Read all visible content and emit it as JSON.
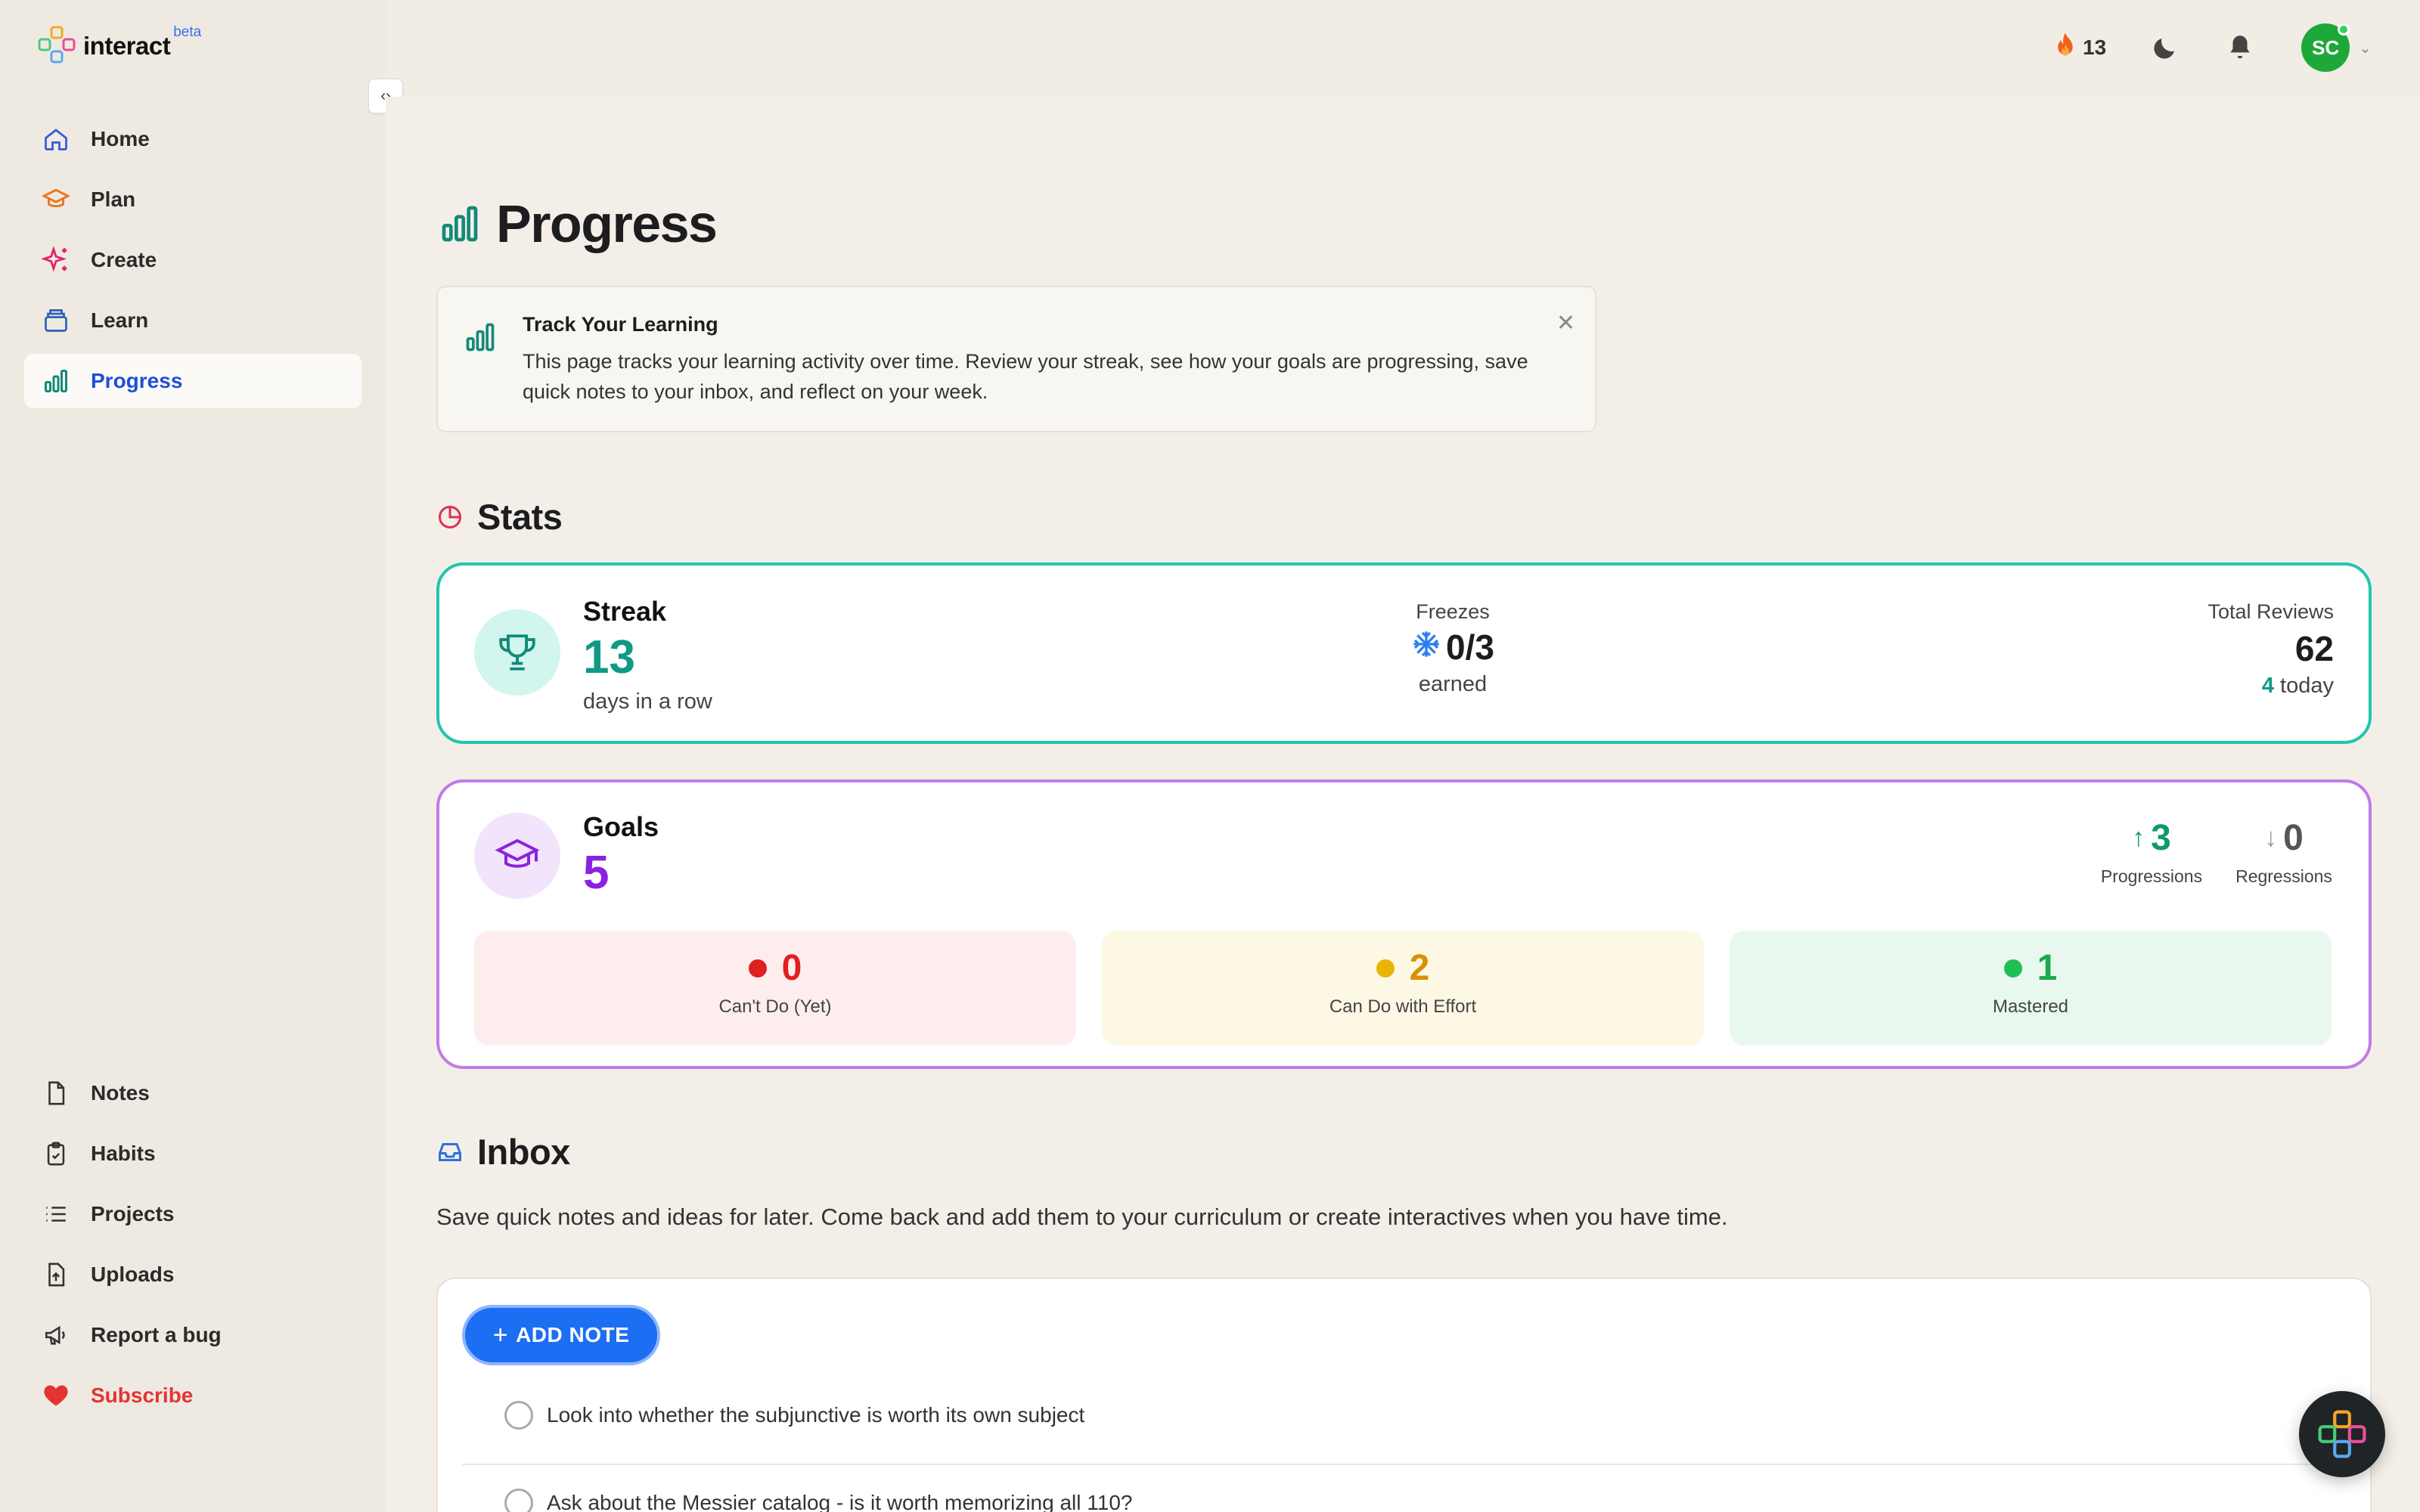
{
  "app": {
    "brand": "interact",
    "beta": "beta"
  },
  "sidebar": {
    "top_items": [
      {
        "label": "Home",
        "icon": "home-icon"
      },
      {
        "label": "Plan",
        "icon": "graduation-cap-icon"
      },
      {
        "label": "Create",
        "icon": "sparkles-icon"
      },
      {
        "label": "Learn",
        "icon": "layers-icon"
      },
      {
        "label": "Progress",
        "icon": "bar-chart-icon",
        "active": true
      }
    ],
    "bottom_items": [
      {
        "label": "Notes",
        "icon": "file-icon"
      },
      {
        "label": "Habits",
        "icon": "clipboard-check-icon"
      },
      {
        "label": "Projects",
        "icon": "list-icon"
      },
      {
        "label": "Uploads",
        "icon": "upload-file-icon"
      },
      {
        "label": "Report a bug",
        "icon": "megaphone-icon"
      },
      {
        "label": "Subscribe",
        "icon": "heart-icon"
      }
    ]
  },
  "topbar": {
    "streak_count": "13",
    "avatar_initials": "SC"
  },
  "page": {
    "title": "Progress"
  },
  "info": {
    "title": "Track Your Learning",
    "text": "This page tracks your learning activity over time. Review your streak, see how your goals are progressing, save quick notes to your inbox, and reflect on your week."
  },
  "stats": {
    "heading": "Stats",
    "streak": {
      "label": "Streak",
      "value": "13",
      "sub": "days in a row"
    },
    "freezes": {
      "label": "Freezes",
      "value": "0/3",
      "sub": "earned"
    },
    "reviews": {
      "label": "Total Reviews",
      "value": "62",
      "today_count": "4",
      "today_label": "today"
    }
  },
  "goals": {
    "label": "Goals",
    "value": "5",
    "progressions": {
      "value": "3",
      "label": "Progressions"
    },
    "regressions": {
      "value": "0",
      "label": "Regressions"
    },
    "tiles": [
      {
        "value": "0",
        "label": "Can't Do (Yet)"
      },
      {
        "value": "2",
        "label": "Can Do with Effort"
      },
      {
        "value": "1",
        "label": "Mastered"
      }
    ]
  },
  "inbox": {
    "heading": "Inbox",
    "description": "Save quick notes and ideas for later. Come back and add them to your curriculum or create interactives when you have time.",
    "add_button": "ADD NOTE",
    "notes": [
      "Look into whether the subjunctive is worth its own subject",
      "Ask about the Messier catalog - is it worth memorizing all 110?"
    ]
  },
  "colors": {
    "accent_blue": "#1f4fd8",
    "streak_teal": "#0f9a86",
    "goals_purple": "#8a22e0",
    "cant_do_red": "#e01f1f",
    "effort_amber": "#d99100",
    "mastered_green": "#1aa84a"
  }
}
